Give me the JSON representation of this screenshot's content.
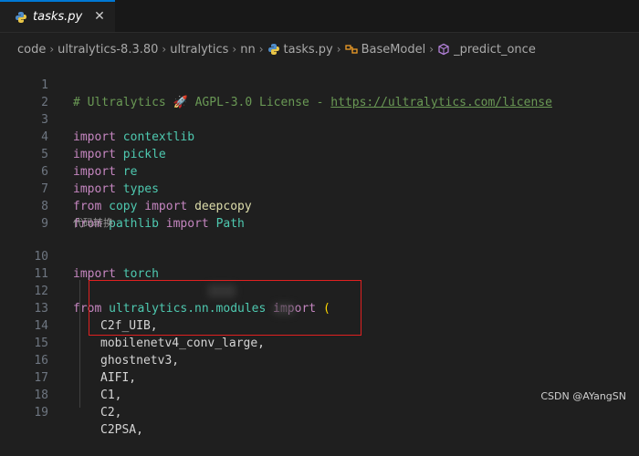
{
  "tab": {
    "label": "tasks.py",
    "close": "✕"
  },
  "breadcrumb": {
    "items": [
      "code",
      "ultralytics-8.3.80",
      "ultralytics",
      "nn",
      "tasks.py",
      "BaseModel",
      "_predict_once"
    ],
    "separator": "›"
  },
  "editor": {
    "line_numbers": [
      "1",
      "2",
      "3",
      "4",
      "5",
      "6",
      "7",
      "8",
      "9",
      "10",
      "11",
      "12",
      "13",
      "14",
      "15",
      "16",
      "17",
      "18",
      "19"
    ],
    "comment": "# Ultralytics 🚀 AGPL-3.0 License - ",
    "license_url": "https://ultralytics.com/license",
    "kw_import": "import",
    "kw_from": "from",
    "contextlib": "contextlib",
    "pickle": "pickle",
    "re": "re",
    "types": "types",
    "copy": "copy",
    "deepcopy": "deepcopy",
    "pathlib": "pathlib",
    "Path": "Path",
    "codelens": "代码转换",
    "torch": "torch",
    "nn_modules": "ultralytics.nn.modules",
    "open_paren": "(",
    "names": [
      "C2f_UIB,",
      "mobilenetv4_conv_large,",
      "ghostnetv3,",
      "AIFI,",
      "C1,",
      "C2,",
      "C2PSA,"
    ]
  },
  "watermark": "CSDN @AYangSN",
  "colors": {
    "accent": "#0078d4",
    "highlight_box": "#e02020"
  }
}
